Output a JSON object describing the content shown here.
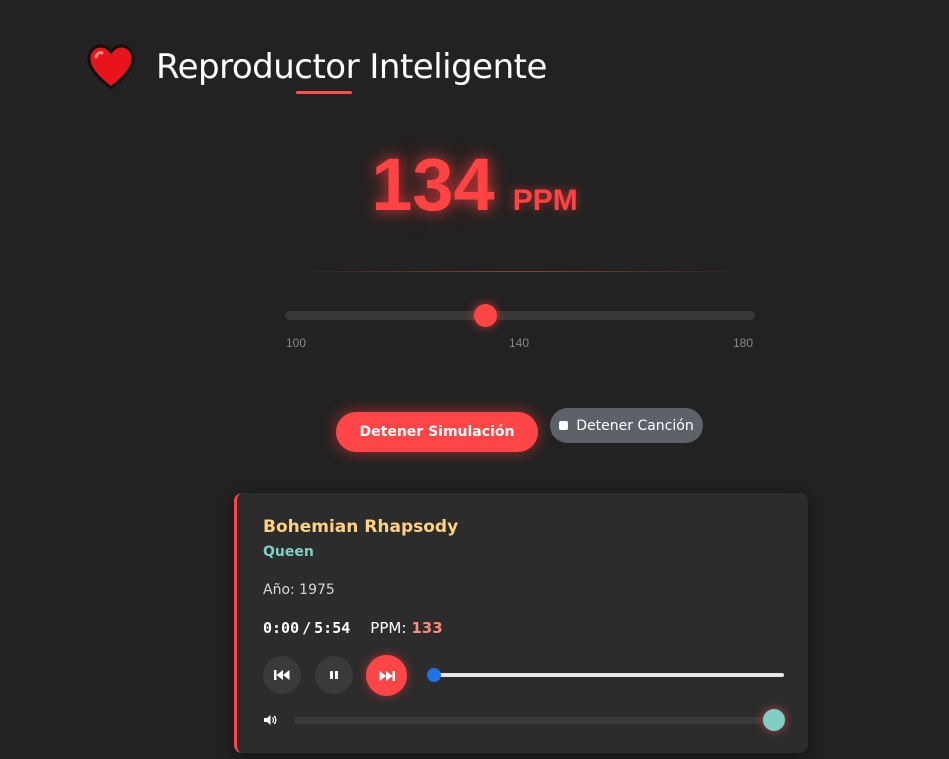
{
  "app": {
    "title": "Reproductor Inteligente",
    "logo_icon": "heart-icon"
  },
  "bpm": {
    "value": "134",
    "unit": "PPM",
    "slider": {
      "min": 100,
      "max": 180,
      "value": 134,
      "ticks": [
        "100",
        "140",
        "180"
      ]
    }
  },
  "actions": {
    "stop_simulation_label": "Detener Simulación",
    "stop_song_label": "Detener Canción",
    "stop_song_icon": "stop-icon"
  },
  "song": {
    "title": "Bohemian Rhapsody",
    "artist": "Queen",
    "year_label": "Año: 1975",
    "current_time": "0:00",
    "separator": "/",
    "total_time": "5:54",
    "ppm_label": "PPM:",
    "ppm_value": "133",
    "progress_fraction": 0.0,
    "volume_fraction": 1.0
  },
  "player_controls": {
    "previous_icon": "skip-previous-icon",
    "pause_icon": "pause-icon",
    "next_icon": "skip-next-icon",
    "volume_icon": "volume-icon"
  },
  "colors": {
    "background": "#222222",
    "accent": "#ff4545",
    "song_title": "#ffd27f",
    "artist": "#7fcfc6",
    "ppm_value": "#ff8a7a",
    "secondary_button": "#5d6168",
    "progress_thumb": "#1a73e8"
  }
}
